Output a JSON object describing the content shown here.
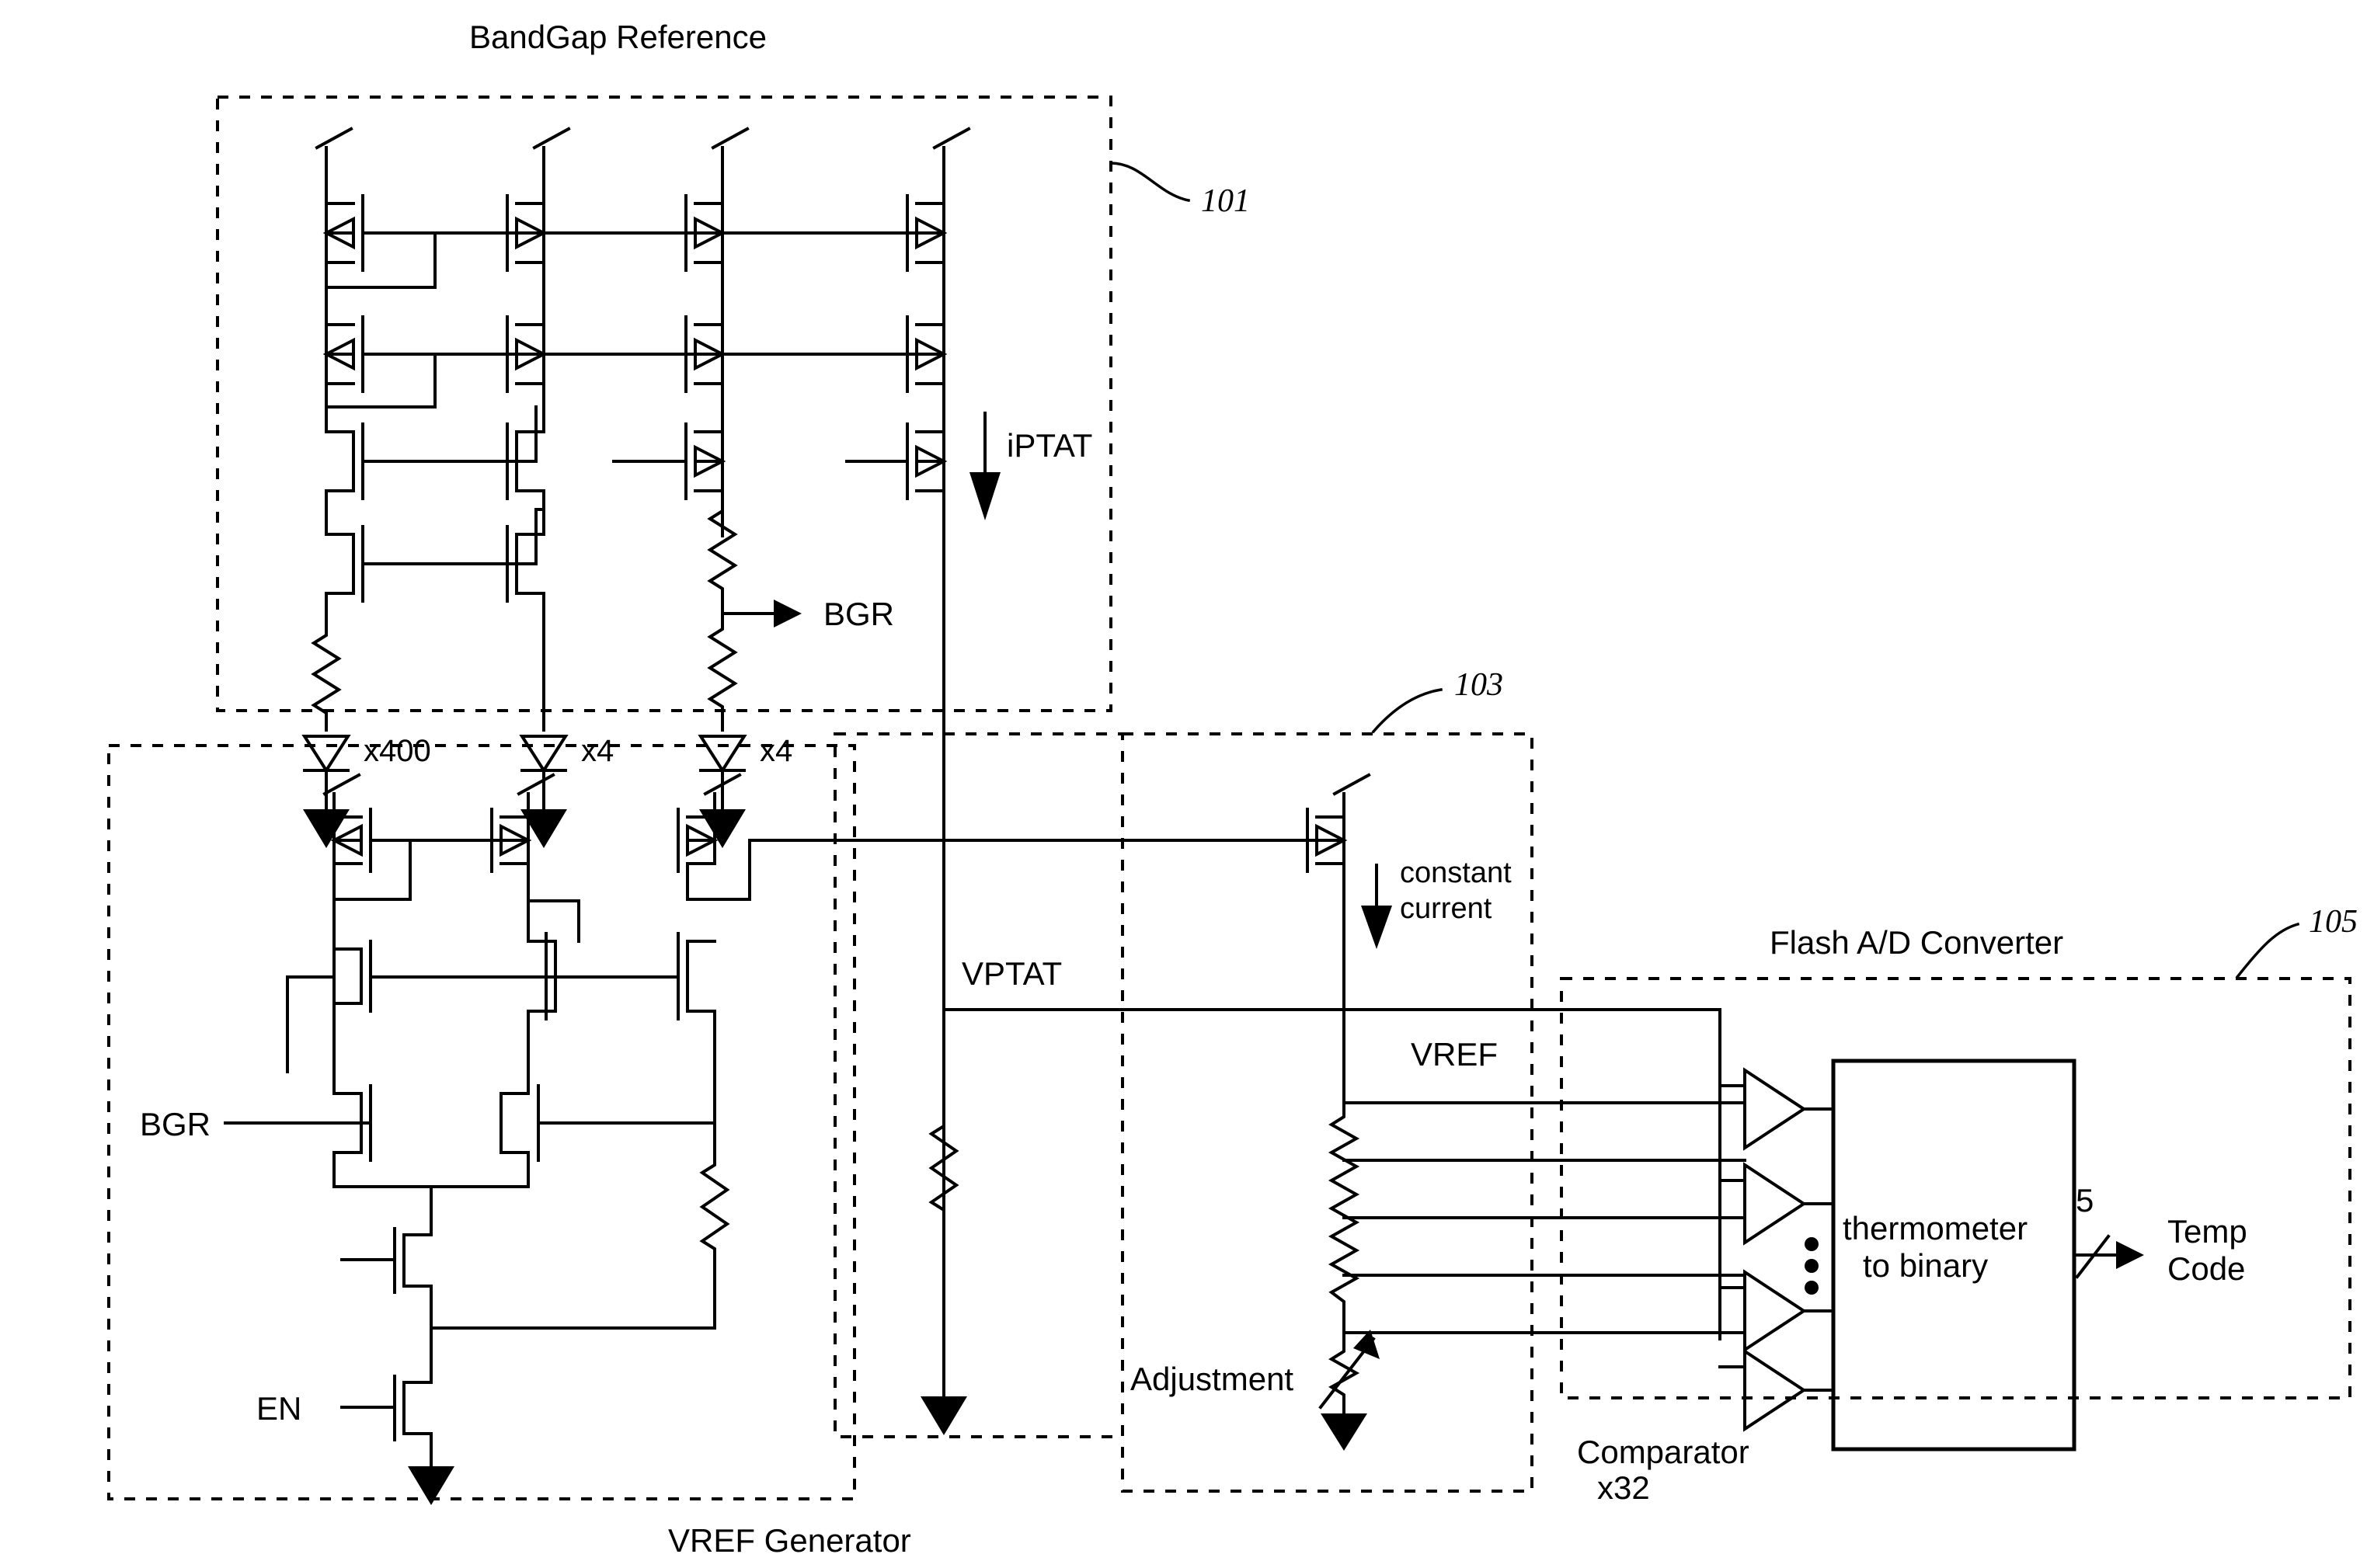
{
  "diagram": {
    "title": "Temperature sensor block diagram schematic",
    "blocks": [
      {
        "id": "bandgap",
        "label": "BandGap Reference",
        "ref": "101"
      },
      {
        "id": "vref_gen",
        "label": "VREF Generator",
        "ref": ""
      },
      {
        "id": "vref_div",
        "label": "",
        "ref": "103"
      },
      {
        "id": "flash_adc",
        "label": "Flash A/D Converter",
        "ref": "105"
      }
    ],
    "signals": {
      "iptat": "iPTAT",
      "bgr_out": "BGR",
      "bgr_in": "BGR",
      "enable": "EN",
      "vptat": "VPTAT",
      "vref": "VREF",
      "constant_current_line1": "constant",
      "constant_current_line2": "current",
      "adjustment": "Adjustment",
      "temp_code_line1": "Temp",
      "temp_code_line2": "Code",
      "bus_width": "5"
    },
    "device_multipliers": [
      {
        "name": "diode-x400",
        "label": "x400"
      },
      {
        "name": "diode-x4-a",
        "label": "x4"
      },
      {
        "name": "diode-x4-b",
        "label": "x4"
      }
    ],
    "adc": {
      "comparator_line1": "Comparator",
      "comparator_line2": "x32",
      "decoder_line1": "thermometer",
      "decoder_line2": "to binary"
    },
    "colors": {
      "ink": "#000000",
      "paper": "#ffffff"
    }
  }
}
